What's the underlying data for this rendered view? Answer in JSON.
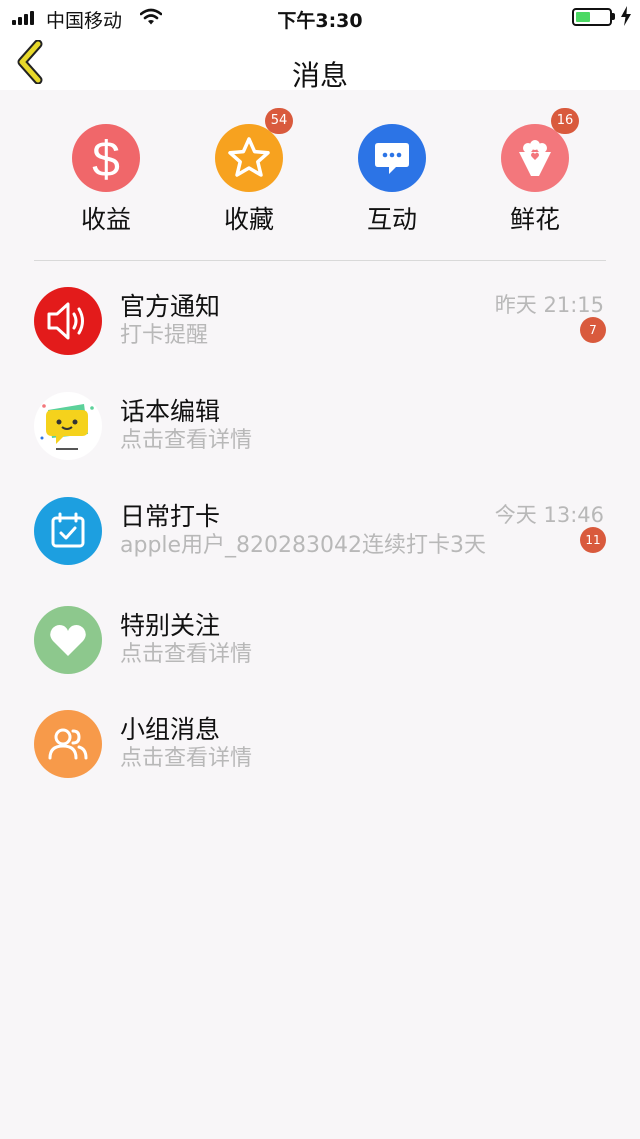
{
  "status_bar": {
    "carrier": "中国移动",
    "time": "下午3:30",
    "battery_level": 0.45
  },
  "nav": {
    "title": "消息",
    "back_icon": "chevron-left-icon"
  },
  "quick_actions": [
    {
      "label": "收益",
      "icon": "dollar-icon",
      "color": "#f0676a",
      "badge": ""
    },
    {
      "label": "收藏",
      "icon": "star-icon",
      "color": "#f7a21f",
      "badge": "54"
    },
    {
      "label": "互动",
      "icon": "chat-bubble-icon",
      "color": "#2c74e6",
      "badge": ""
    },
    {
      "label": "鲜花",
      "icon": "flower-bouquet-icon",
      "color": "#f3777c",
      "badge": "16"
    }
  ],
  "messages": [
    {
      "title": "官方通知",
      "subtitle": "打卡提醒",
      "time": "昨天 21:15",
      "badge": "7",
      "icon": "speaker-icon",
      "color": "#e31b1b"
    },
    {
      "title": "话本编辑",
      "subtitle": "点击查看详情",
      "time": "",
      "badge": "",
      "icon": "editor-avatar-icon",
      "color": "#ffffff"
    },
    {
      "title": "日常打卡",
      "subtitle": "apple用户_820283042连续打卡3天",
      "time": "今天 13:46",
      "badge": "11",
      "icon": "calendar-check-icon",
      "color": "#1d9fe0"
    },
    {
      "title": "特别关注",
      "subtitle": "点击查看详情",
      "time": "",
      "badge": "",
      "icon": "heart-icon",
      "color": "#8dc88d"
    },
    {
      "title": "小组消息",
      "subtitle": "点击查看详情",
      "time": "",
      "badge": "",
      "icon": "group-icon",
      "color": "#f79a4a"
    }
  ],
  "colors": {
    "badge": "#d95a3d",
    "subtitle_gray": "#b8b8b8",
    "back_arrow": "#e8d92a"
  }
}
